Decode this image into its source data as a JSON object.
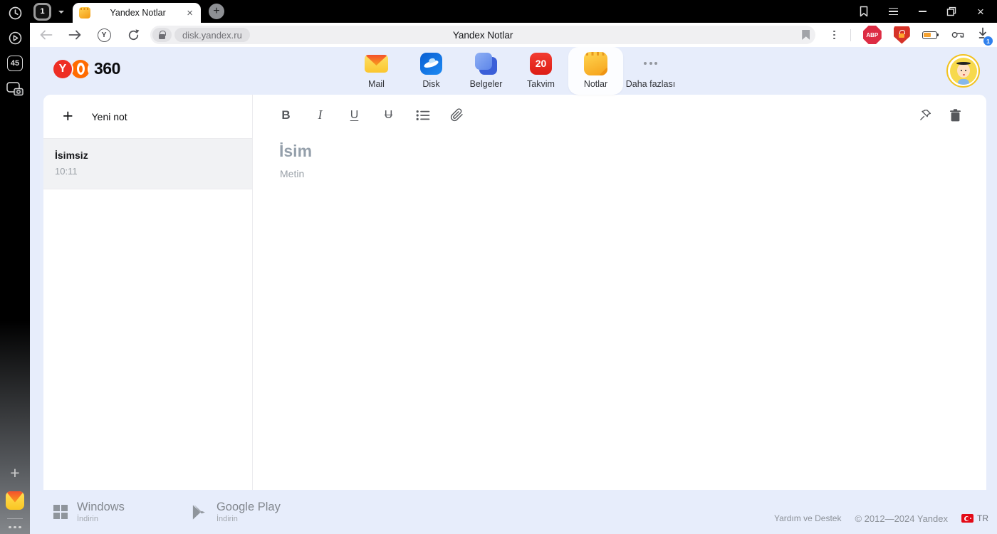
{
  "browser": {
    "sidebar": {
      "tab_count": "45"
    },
    "tabbar": {
      "group_count": "1",
      "tab_title": "Yandex Notlar",
      "close_glyph": "×",
      "new_tab_glyph": "+"
    },
    "toolbar": {
      "url": "disk.yandex.ru",
      "page_title": "Yandex Notlar",
      "abp_label": "ABP",
      "download_badge": "1",
      "ybrowser_glyph": "Y"
    }
  },
  "app": {
    "header": {
      "logo_y": "Y",
      "logo_text": "360",
      "nav": [
        {
          "label": "Mail"
        },
        {
          "label": "Disk"
        },
        {
          "label": "Belgeler"
        },
        {
          "label": "Takvim",
          "badge": "20"
        },
        {
          "label": "Notlar"
        },
        {
          "label": "Daha fazlası"
        }
      ]
    },
    "notes": {
      "new_note": "Yeni not",
      "plus_glyph": "+",
      "items": [
        {
          "title": "İsimsiz",
          "time": "10:11"
        }
      ]
    },
    "editor": {
      "bold": "B",
      "italic": "I",
      "underline": "U",
      "strike": "U",
      "title_placeholder": "İsim",
      "body_placeholder": "Metin"
    },
    "footer": {
      "windows_title": "Windows",
      "windows_sub": "İndirin",
      "gplay_title": "Google Play",
      "gplay_sub": "İndirin",
      "help": "Yardım ve Destek",
      "copyright": "© 2012—2024 Yandex",
      "lang": "TR"
    }
  }
}
